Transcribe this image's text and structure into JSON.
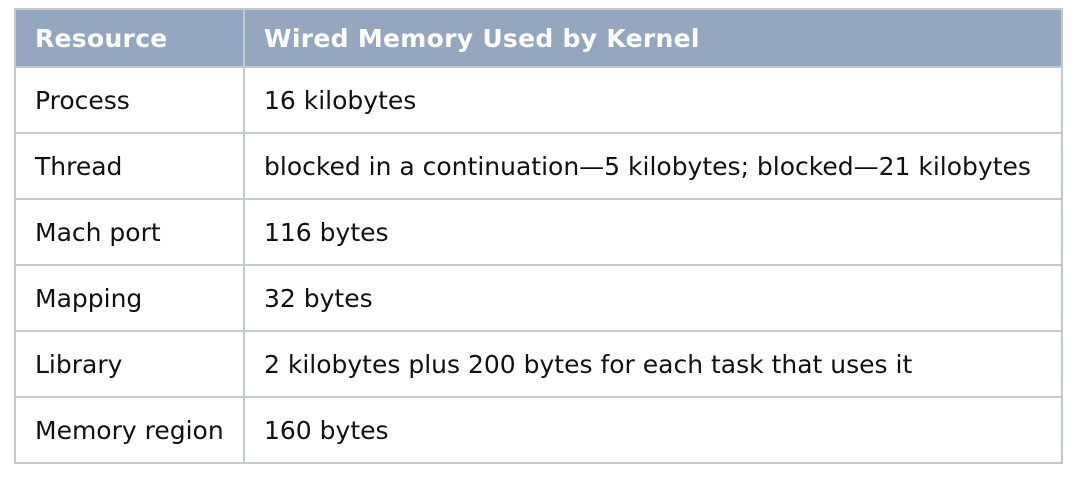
{
  "table": {
    "headers": [
      "Resource",
      "Wired Memory Used by Kernel"
    ],
    "rows": [
      [
        "Process",
        "16 kilobytes"
      ],
      [
        "Thread",
        "blocked in a continuation—5 kilobytes; blocked—21 kilobytes"
      ],
      [
        "Mach port",
        "116 bytes"
      ],
      [
        "Mapping",
        "32 bytes"
      ],
      [
        "Library",
        "2 kilobytes plus 200 bytes for each task that uses it"
      ],
      [
        "Memory region",
        "160 bytes"
      ]
    ]
  }
}
